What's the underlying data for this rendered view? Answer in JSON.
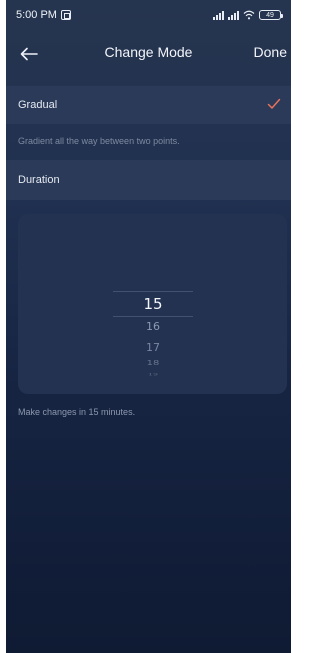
{
  "status_bar": {
    "time": "5:00 PM",
    "battery": "49"
  },
  "header": {
    "title": "Change Mode",
    "done_label": "Done"
  },
  "mode": {
    "label": "Gradual",
    "selected": true,
    "description": "Gradient all the way between two points."
  },
  "duration": {
    "label": "Duration",
    "picker_values": [
      "15",
      "16",
      "17",
      "18",
      "19"
    ],
    "selected_value": "15"
  },
  "footnote": "Make changes in 15 minutes.",
  "colors": {
    "accent_check": "#e8735a",
    "row_bg": "#2a3a58",
    "card_bg": "#223250"
  }
}
